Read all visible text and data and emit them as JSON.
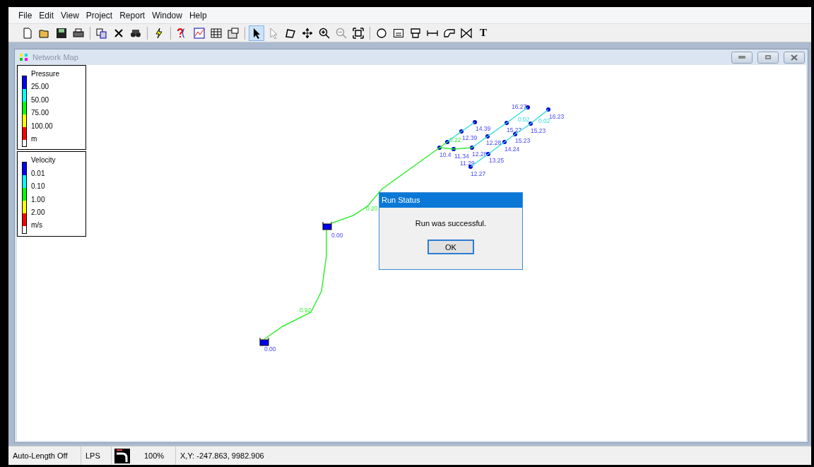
{
  "menu": [
    "File",
    "Edit",
    "View",
    "Project",
    "Report",
    "Window",
    "Help"
  ],
  "toolbar": [
    [
      {
        "kind": "new",
        "selected": false
      },
      {
        "kind": "open",
        "selected": false
      },
      {
        "kind": "save",
        "selected": false
      },
      {
        "kind": "print",
        "selected": false
      }
    ],
    [
      {
        "kind": "copy",
        "selected": false
      },
      {
        "kind": "delete",
        "selected": false
      },
      {
        "kind": "find",
        "selected": false
      }
    ],
    [
      {
        "kind": "run",
        "selected": false
      }
    ],
    [
      {
        "kind": "query",
        "selected": false
      },
      {
        "kind": "graph",
        "selected": false
      },
      {
        "kind": "table",
        "selected": false
      },
      {
        "kind": "options",
        "selected": false
      }
    ],
    [
      {
        "kind": "select",
        "selected": true
      },
      {
        "kind": "vertex",
        "selected": false
      },
      {
        "kind": "region",
        "selected": false
      },
      {
        "kind": "pan",
        "selected": false
      },
      {
        "kind": "zoom-in",
        "selected": false
      },
      {
        "kind": "zoom-out",
        "selected": false
      },
      {
        "kind": "extent",
        "selected": false
      }
    ],
    [
      {
        "kind": "junction",
        "selected": false
      },
      {
        "kind": "reservoir",
        "selected": false
      },
      {
        "kind": "tank",
        "selected": false
      },
      {
        "kind": "pipe",
        "selected": false
      },
      {
        "kind": "pump",
        "selected": false
      },
      {
        "kind": "valve",
        "selected": false
      },
      {
        "kind": "label",
        "text": "T",
        "selected": false
      }
    ]
  ],
  "window": {
    "title": "Network Map"
  },
  "legends": [
    {
      "title": "Pressure",
      "unit": "m",
      "bands": [
        {
          "color": "#0000ff"
        },
        {
          "color": "#00ffff"
        },
        {
          "color": "#00ff00"
        },
        {
          "color": "#ffff00"
        },
        {
          "color": "#ff0000"
        }
      ],
      "stops": [
        "25.00",
        "50.00",
        "75.00",
        "100.00"
      ]
    },
    {
      "title": "Velocity",
      "unit": "m/s",
      "bands": [
        {
          "color": "#0000ff"
        },
        {
          "color": "#00ffff"
        },
        {
          "color": "#00ff00"
        },
        {
          "color": "#ffff00"
        },
        {
          "color": "#ff0000"
        }
      ],
      "stops": [
        "0.01",
        "0.10",
        "1.00",
        "2.00"
      ]
    }
  ],
  "nodes": [
    {
      "kind": "tank",
      "label": "0.00"
    },
    {
      "kind": "tank",
      "label": "0.00"
    },
    {
      "kind": "junction",
      "label": "10.4"
    },
    {
      "kind": "junction",
      "label": "11.29"
    },
    {
      "kind": "junction",
      "label": "11.34"
    },
    {
      "kind": "junction",
      "label": "12.39"
    },
    {
      "kind": "junction",
      "label": "14.39"
    },
    {
      "kind": "junction",
      "label": "12.28"
    },
    {
      "kind": "junction",
      "label": "12.28"
    },
    {
      "kind": "junction",
      "label": "14.24"
    },
    {
      "kind": "junction",
      "label": "13.25"
    },
    {
      "kind": "junction",
      "label": "12.27"
    },
    {
      "kind": "junction",
      "label": "15.27"
    },
    {
      "kind": "junction",
      "label": "15.23"
    },
    {
      "kind": "junction",
      "label": "16.27"
    },
    {
      "kind": "junction",
      "label": "15.23"
    },
    {
      "kind": "junction",
      "label": "16.23"
    }
  ],
  "links": [
    {
      "color": "#33ee33",
      "label": "0.92"
    },
    {
      "color": "#33ee33",
      "label": "0.20"
    },
    {
      "color": "#33ee33",
      "label": "0.22"
    },
    {
      "color": "#33ee33"
    },
    {
      "color": "#33ee33"
    },
    {
      "color": "#33dddd"
    },
    {
      "color": "#33dddd"
    },
    {
      "color": "#33dddd"
    },
    {
      "color": "#33dddd"
    },
    {
      "color": "#33dddd",
      "label": "0.02"
    },
    {
      "color": "#33dddd"
    },
    {
      "color": "#33dddd"
    },
    {
      "color": "#33dddd"
    },
    {
      "color": "#33dddd"
    },
    {
      "color": "#33dddd",
      "label": "0.02"
    }
  ],
  "dialog": {
    "title": "Run Status",
    "message": "Run was successful.",
    "button": "OK"
  },
  "status_bar": {
    "auto_length": "Auto-Length Off",
    "units": "LPS",
    "zoom": "100%",
    "coords": "X,Y: -247.863, 9982.906"
  }
}
